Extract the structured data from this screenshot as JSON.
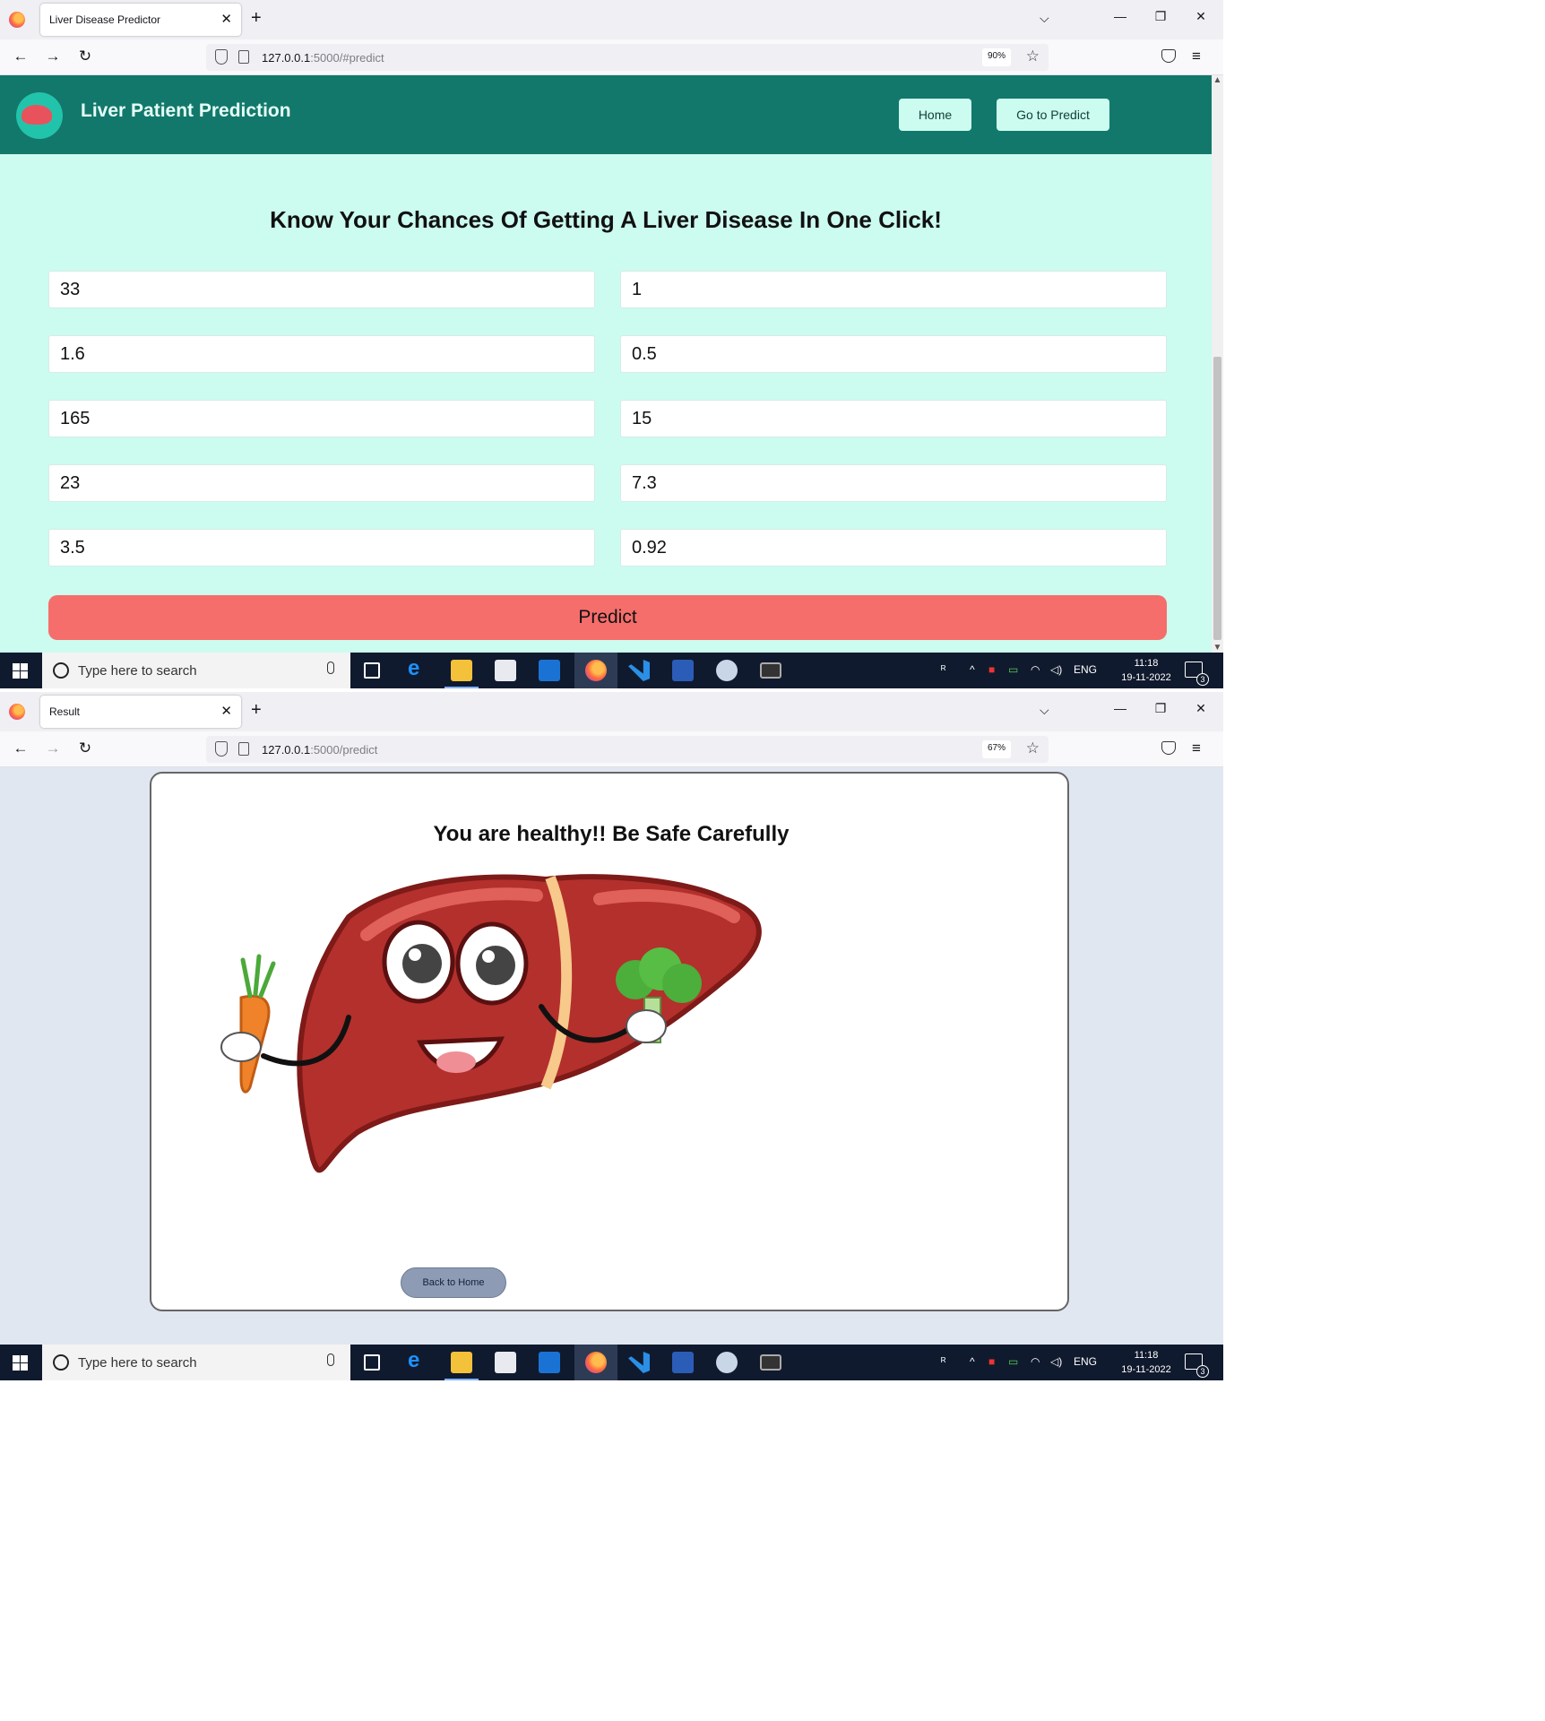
{
  "shot1": {
    "browser": {
      "tab_title": "Liver Disease Predictor",
      "url_host": "127.0.0.1",
      "url_path": ":5000/#predict",
      "zoom": "90%"
    },
    "header": {
      "brand": "Liver Patient Prediction",
      "home_button": "Home",
      "predict_nav_button": "Go to Predict"
    },
    "form": {
      "title": "Know Your Chances Of Getting A Liver Disease In One Click!",
      "fields": [
        "33",
        "1",
        "1.6",
        "0.5",
        "165",
        "15",
        "23",
        "7.3",
        "3.5",
        "0.92"
      ],
      "submit_label": "Predict"
    }
  },
  "shot2": {
    "browser": {
      "tab_title": "Result",
      "url_host": "127.0.0.1",
      "url_path": ":5000/predict",
      "zoom": "67%"
    },
    "result": {
      "message": "You are healthy!! Be Safe Carefully",
      "back_button": "Back to Home"
    }
  },
  "taskbar": {
    "search_placeholder": "Type here to search",
    "language": "ENG",
    "time": "11:18",
    "date": "19-11-2022",
    "notification_count": "3"
  },
  "colors": {
    "header_bg": "#12786b",
    "page_bg": "#ccfbef",
    "predict_button": "#f56e6c",
    "result_page_bg": "#e1e7f0",
    "back_button": "#8d9bb4"
  }
}
